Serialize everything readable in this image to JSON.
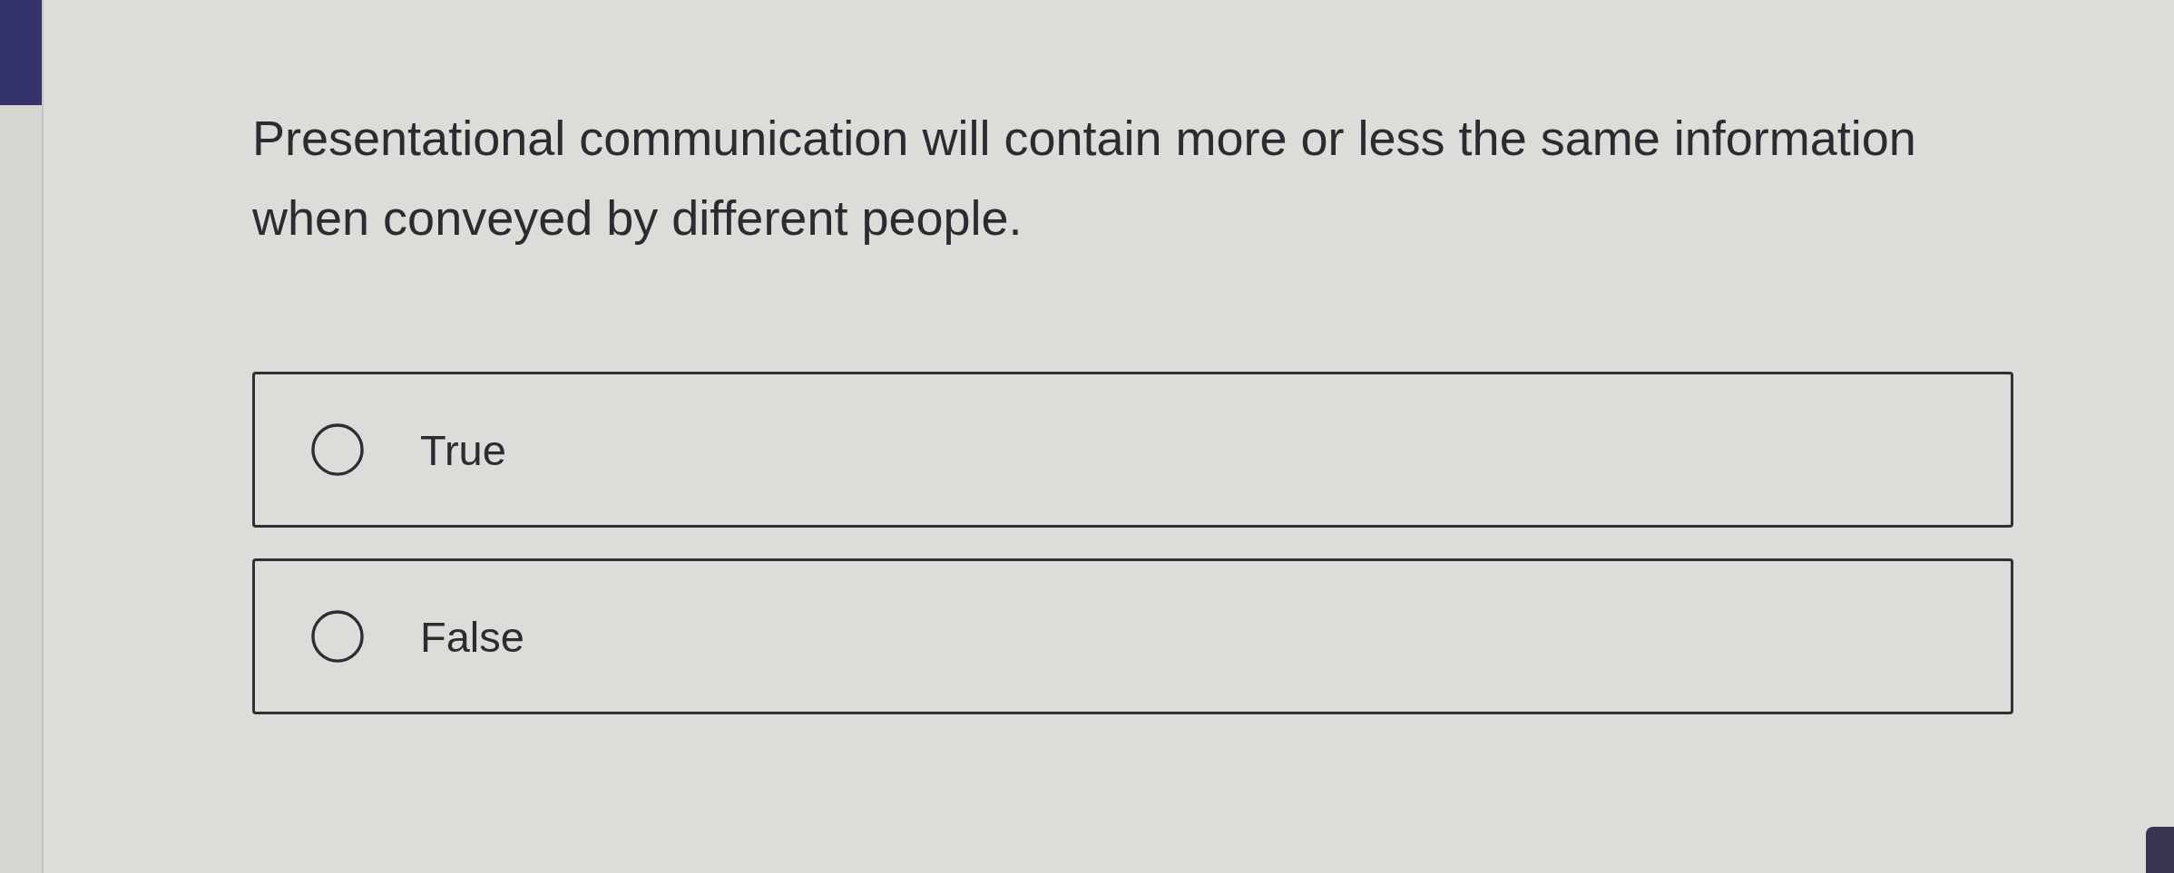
{
  "question": {
    "text": "Presentational communication will contain more or less the same information when conveyed by different people."
  },
  "options": [
    {
      "label": "True",
      "selected": false
    },
    {
      "label": "False",
      "selected": false
    }
  ]
}
